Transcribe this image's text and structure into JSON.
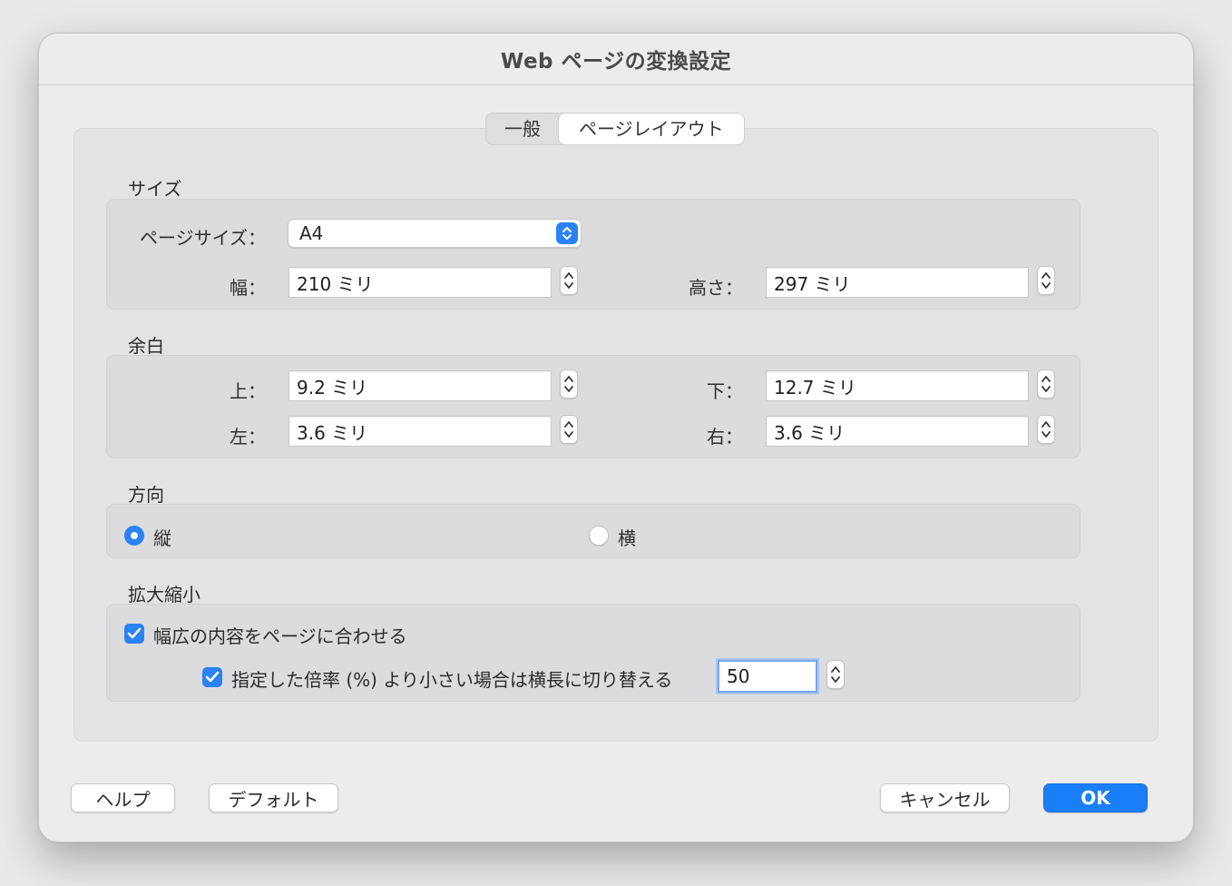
{
  "window": {
    "title": "Web ページの変換設定"
  },
  "tabs": [
    {
      "label": "一般",
      "active": false
    },
    {
      "label": "ページレイアウト",
      "active": true
    }
  ],
  "size": {
    "section": "サイズ",
    "page_size_label": "ページサイズ：",
    "page_size_value": "A4",
    "width_label": "幅：",
    "width_value": "210 ミリ",
    "height_label": "高さ：",
    "height_value": "297 ミリ"
  },
  "margins": {
    "section": "余白",
    "top_label": "上：",
    "top_value": "9.2 ミリ",
    "bottom_label": "下：",
    "bottom_value": "12.7 ミリ",
    "left_label": "左：",
    "left_value": "3.6 ミリ",
    "right_label": "右：",
    "right_value": "3.6 ミリ"
  },
  "orientation": {
    "section": "方向",
    "portrait_label": "縦",
    "portrait_selected": true,
    "landscape_label": "横",
    "landscape_selected": false
  },
  "scaling": {
    "section": "拡大縮小",
    "fit_label": "幅広の内容をページに合わせる",
    "fit_checked": true,
    "switch_label": "指定した倍率 (%) より小さい場合は横長に切り替える",
    "switch_checked": true,
    "percent_value": "50"
  },
  "buttons": {
    "help": "ヘルプ",
    "default": "デフォルト",
    "cancel": "キャンセル",
    "ok": "OK"
  },
  "colors": {
    "accent": "#2b82f5",
    "primary_button": "#1a7ff6"
  }
}
